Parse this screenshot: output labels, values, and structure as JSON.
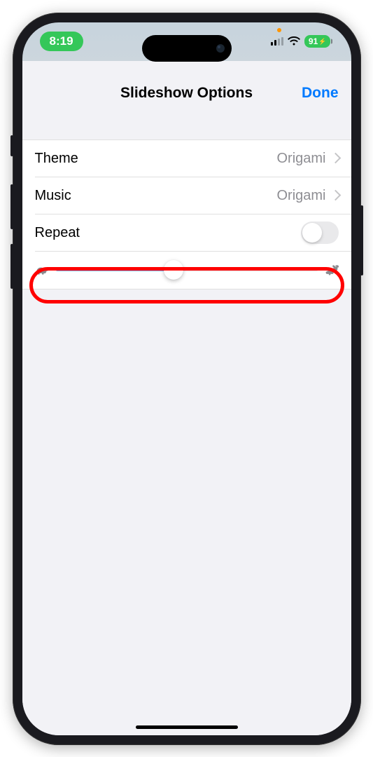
{
  "status": {
    "time": "8:19",
    "battery": "91"
  },
  "header": {
    "title": "Slideshow Options",
    "done": "Done"
  },
  "rows": {
    "theme": {
      "label": "Theme",
      "value": "Origami"
    },
    "music": {
      "label": "Music",
      "value": "Origami"
    },
    "repeat": {
      "label": "Repeat",
      "enabled": false
    }
  },
  "slider": {
    "value_percent": 45
  },
  "annotation": {
    "target": "speed-slider-row"
  }
}
